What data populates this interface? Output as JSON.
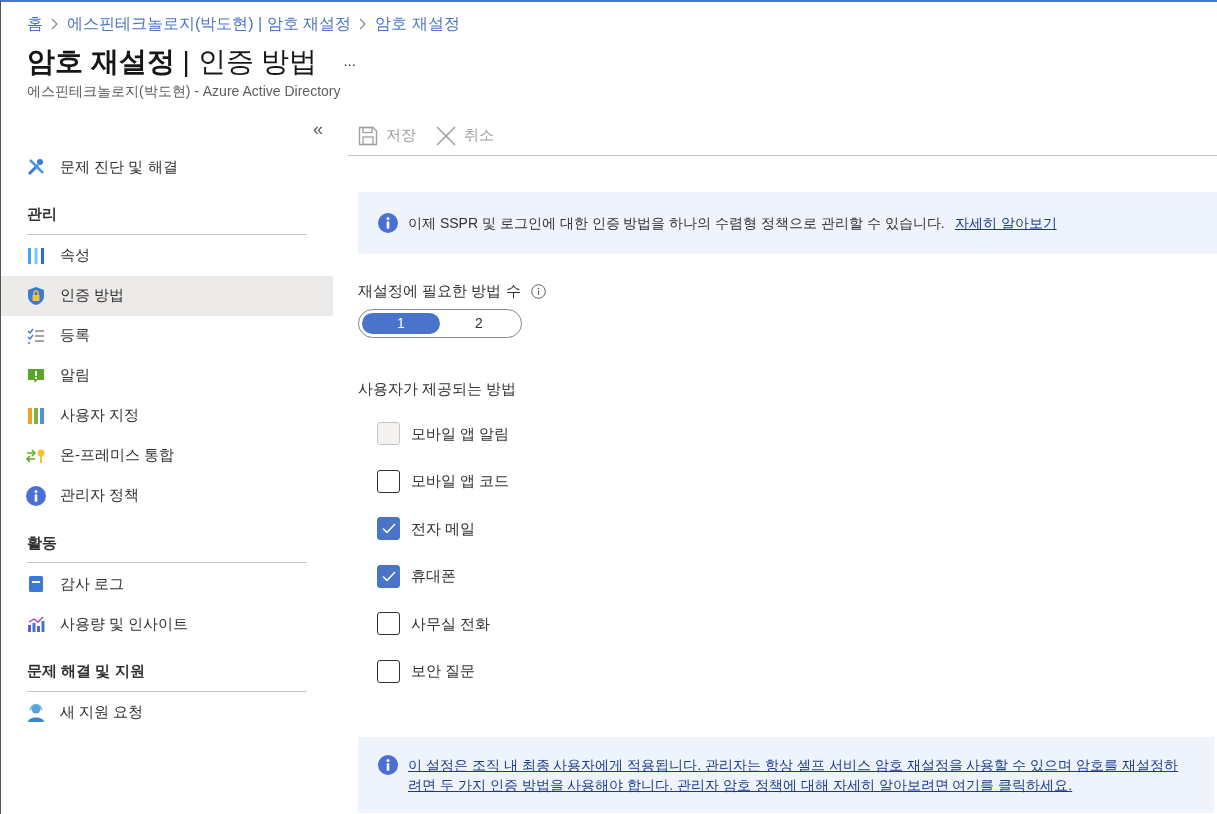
{
  "breadcrumb": [
    "홈",
    "에스핀테크놀로지(박도현) | 암호 재설정",
    "암호 재설정"
  ],
  "header": {
    "title": "**암호 재설정** | 인증 방법",
    "more": "...",
    "description": "에스핀테크놀로지(박도현) - Azure Active Directory"
  },
  "sidebar": {
    "collapse": "«",
    "top_item": {
      "label": "문제 진단 및 해결",
      "selected": false
    },
    "sections": [
      {
        "title": "관리",
        "items": [
          {
            "label": "속성",
            "selected": false
          },
          {
            "label": "인증 방법",
            "selected": true
          },
          {
            "label": "등록",
            "selected": false
          },
          {
            "label": "알림",
            "selected": false
          },
          {
            "label": "사용자 지정",
            "selected": false
          },
          {
            "label": "온-프레미스 통합",
            "selected": false
          },
          {
            "label": "관리자 정책",
            "selected": false
          }
        ]
      },
      {
        "title": "활동",
        "items": [
          {
            "label": "감사 로그",
            "selected": false
          },
          {
            "label": "사용량 및 인사이트",
            "selected": false
          }
        ]
      },
      {
        "title": "문제 해결 및 지원",
        "items": [
          {
            "label": "새 지원 요청",
            "selected": false
          }
        ]
      }
    ]
  },
  "toolbar": [
    {
      "label": "저장",
      "kind": "save",
      "disabled": true
    },
    {
      "label": "취소",
      "kind": "cancel",
      "disabled": true
    }
  ],
  "info_banner": {
    "text": "이제 SSPR 및 로그인에 대한 인증 방법을 하나의 수렴형 정책으로 관리할 수 있습니다.",
    "link": "자세히 알아보기"
  },
  "methods_required": {
    "label": "재설정에 필요한 방법 수",
    "options": [
      {
        "label": "1",
        "selected": true
      },
      {
        "label": "2",
        "selected": false
      }
    ]
  },
  "methods": {
    "label": "사용자가 제공되는 방법",
    "items": [
      {
        "label": "모바일 앱 알림",
        "checked": false,
        "disabled": true
      },
      {
        "label": "모바일 앱 코드",
        "checked": false,
        "disabled": false
      },
      {
        "label": "전자 메일",
        "checked": true,
        "disabled": false
      },
      {
        "label": "휴대폰",
        "checked": true,
        "disabled": false
      },
      {
        "label": "사무실 전화",
        "checked": false,
        "disabled": false
      },
      {
        "label": "보안 질문",
        "checked": false,
        "disabled": false
      }
    ]
  },
  "footer_banner": {
    "link": "이 설정은 조직 내 최종 사용자에게 적용됩니다. 관리자는 항상 셀프 서비스 암호 재설정을 사용할 수 있으며 암호를 재설정하려면 두 가지 인증 방법을 사용해야 합니다. 관리자 암호 정책에 대해 자세히 알아보려면 여기를 클릭하세요."
  }
}
